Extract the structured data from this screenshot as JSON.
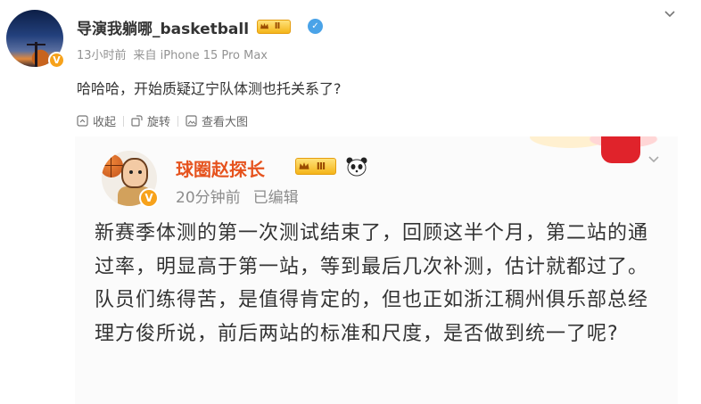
{
  "post": {
    "username": "导演我躺哪_basketball",
    "level_badge": "Ⅱ",
    "meta": {
      "time": "13小时前",
      "source": "来自 iPhone 15 Pro Max"
    },
    "text": "哈哈哈，开始质疑辽宁队体测也托关系了?",
    "actions": [
      {
        "label": "收起",
        "icon": "collapse-icon"
      },
      {
        "label": "旋转",
        "icon": "rotate-icon"
      },
      {
        "label": "查看大图",
        "icon": "view-large-image-icon"
      }
    ]
  },
  "quoted": {
    "username": "球圈赵探长",
    "level_badge": "Ⅲ",
    "meta": {
      "time": "20分钟前",
      "edited": "已编辑"
    },
    "body": "新赛季体测的第一次测试结束了，回顾这半个月，第二站的通过率，明显高于第一站，等到最后几次补测，估计就都过了。队员们练得苦，是值得肯定的，但也正如浙江稠州俱乐部总经理方俊所说，前后两站的标准和尺度，是否做到统一了呢?"
  },
  "verified_badge": "V",
  "colors": {
    "quoted_name": "#e6531e",
    "level_gold": "#f4b519",
    "verified_orange": "#f7a21b"
  }
}
